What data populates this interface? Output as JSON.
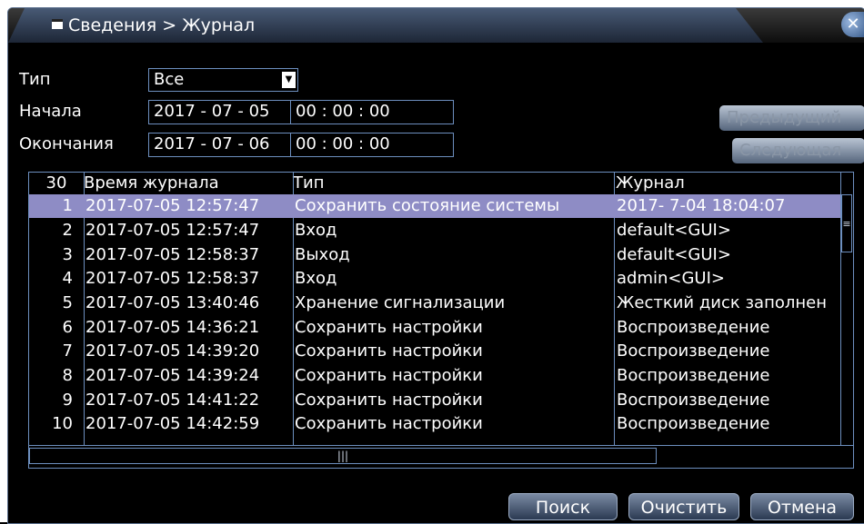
{
  "window": {
    "title": "Сведения > Журнал"
  },
  "filters": {
    "type_label": "Тип",
    "type_value": "Все",
    "start_label": "Начала",
    "start_date": "2017 - 07 - 05",
    "start_time": "00 : 00 : 00",
    "end_label": "Окончания",
    "end_date": "2017 - 07 - 06",
    "end_time": "00 : 00 : 00"
  },
  "side_buttons": {
    "prev": "Предыдущий",
    "next": "Следующая"
  },
  "table": {
    "count": "30",
    "columns": {
      "time": "Время журнала",
      "type": "Тип",
      "log": "Журнал"
    },
    "rows": [
      {
        "n": "1",
        "time": "2017-07-05 12:57:47",
        "type": "Сохранить состояние системы",
        "log": "2017- 7-04 18:04:07"
      },
      {
        "n": "2",
        "time": "2017-07-05 12:57:47",
        "type": "Вход",
        "log": "default<GUI>"
      },
      {
        "n": "3",
        "time": "2017-07-05 12:58:37",
        "type": "Выход",
        "log": "default<GUI>"
      },
      {
        "n": "4",
        "time": "2017-07-05 12:58:37",
        "type": "Вход",
        "log": "admin<GUI>"
      },
      {
        "n": "5",
        "time": "2017-07-05 13:40:46",
        "type": "Хранение сигнализации",
        "log": "Жесткий диск заполнен"
      },
      {
        "n": "6",
        "time": "2017-07-05 14:36:21",
        "type": "Сохранить настройки",
        "log": "Воспроизведение"
      },
      {
        "n": "7",
        "time": "2017-07-05 14:39:20",
        "type": "Сохранить настройки",
        "log": "Воспроизведение"
      },
      {
        "n": "8",
        "time": "2017-07-05 14:39:24",
        "type": "Сохранить настройки",
        "log": "Воспроизведение"
      },
      {
        "n": "9",
        "time": "2017-07-05 14:41:22",
        "type": "Сохранить настройки",
        "log": "Воспроизведение"
      },
      {
        "n": "10",
        "time": "2017-07-05 14:42:59",
        "type": "Сохранить настройки",
        "log": "Воспроизведение"
      }
    ]
  },
  "buttons": {
    "search": "Поиск",
    "clear": "Очистить",
    "cancel": "Отмена"
  }
}
